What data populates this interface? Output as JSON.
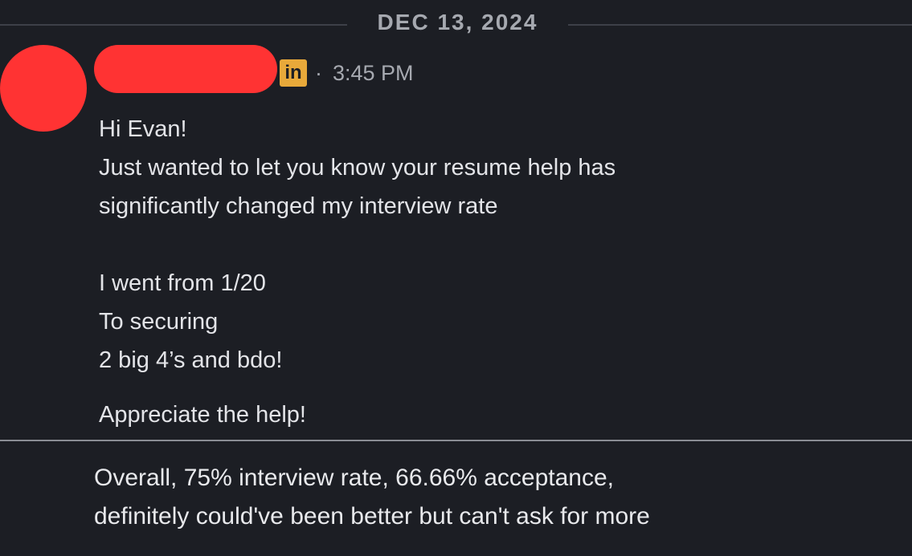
{
  "date_divider": {
    "label": "DEC 13, 2024"
  },
  "message": {
    "sender_avatar": "redacted-avatar",
    "sender_name": "redacted-name",
    "source_icon": "linkedin-icon",
    "source_icon_text": "in",
    "separator_dot": "·",
    "time": "3:45 PM",
    "lines": [
      "Hi Evan!",
      "Just wanted to let you know your resume help has",
      "significantly changed my interview rate",
      "",
      "I went from 1/20",
      "To securing",
      "2 big 4’s and bdo!"
    ],
    "sign_off": "Appreciate the help!"
  },
  "caption": {
    "lines": [
      "Overall, 75% interview rate, 66.66% acceptance,",
      "definitely could've been better but can't ask for more"
    ]
  },
  "colors": {
    "background": "#1c1e24",
    "redaction": "#ff3333",
    "linkedin_badge": "#e8a93a",
    "muted_text": "#a6a9b0",
    "body_text": "#e3e4e8"
  }
}
